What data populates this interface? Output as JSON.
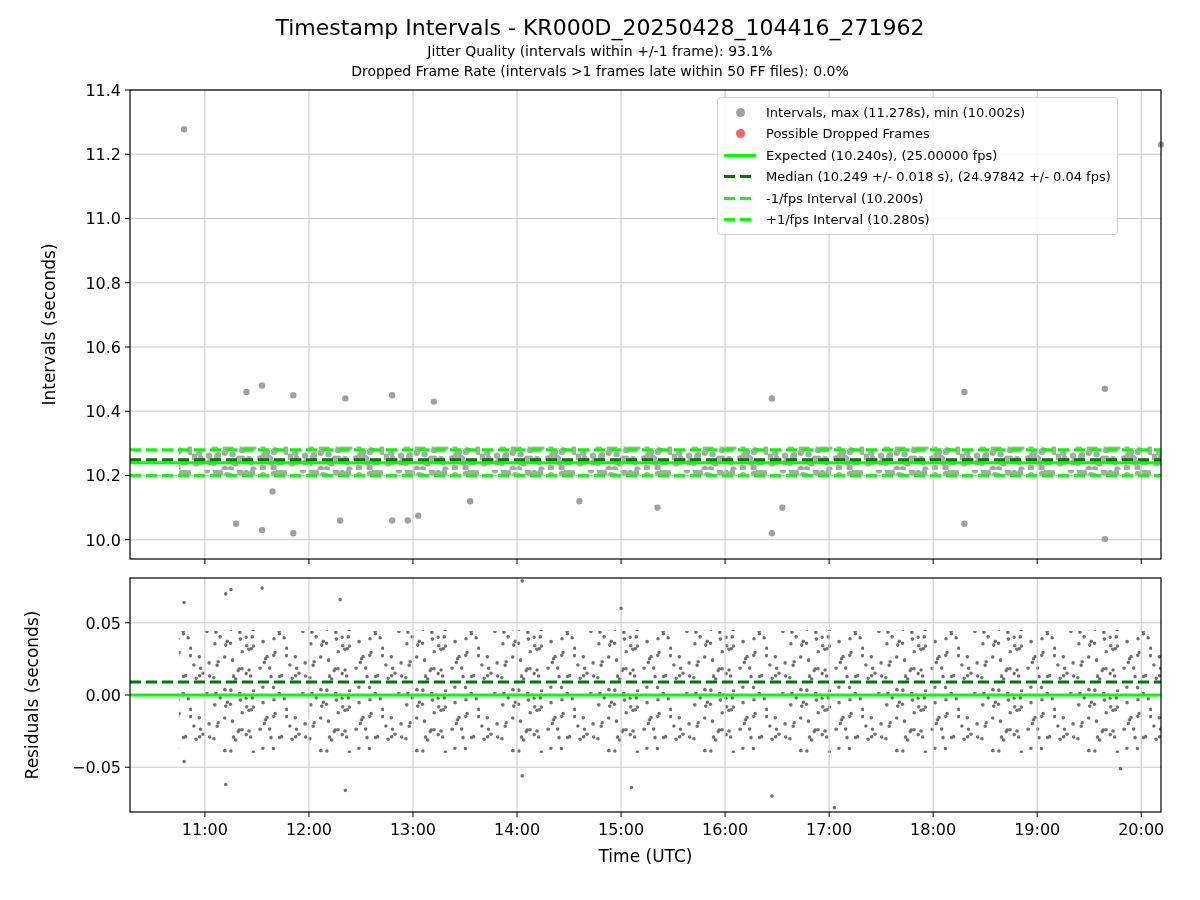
{
  "title": "Timestamp Intervals - KR000D_20250428_104416_271962",
  "subtitles": [
    "Jitter Quality (intervals within +/-1 frame): 93.1%",
    "Dropped Frame Rate (intervals >1 frames late within 50 FF files): 0.0%"
  ],
  "top_panel": {
    "legend_markers": [
      {
        "label": "Possible Dropped Frames",
        "color": "#ff6060"
      }
    ],
    "chart_data": {
      "type": "scatter",
      "ylabel": "Intervals (seconds)",
      "grid": true,
      "xlim": [
        10.28,
        20.19
      ],
      "ylim": [
        9.94,
        11.4
      ],
      "yticks": [
        {
          "value": 10.0,
          "label": "10.0"
        },
        {
          "value": 10.2,
          "label": "10.2"
        },
        {
          "value": 10.4,
          "label": "10.4"
        },
        {
          "value": 10.6,
          "label": "10.6"
        },
        {
          "value": 10.8,
          "label": "10.8"
        },
        {
          "value": 11.0,
          "label": "11.0"
        },
        {
          "value": 11.2,
          "label": "11.2"
        },
        {
          "value": 11.4,
          "label": "11.4"
        }
      ],
      "series": [
        {
          "name": "Intervals, max (11.278s), min (10.002s)",
          "color": "#a0a0a0",
          "x": [
            10.8,
            20.19,
            11.55,
            11.4,
            11.85,
            12.8,
            18.3,
            19.65,
            12.35,
            16.45,
            13.2,
            11.3,
            11.85,
            11.55,
            12.3,
            12.8,
            12.95,
            13.05,
            15.35,
            16.45,
            18.3,
            19.65,
            16.55,
            14.6,
            13.55,
            11.65
          ],
          "values": [
            11.278,
            11.23,
            10.48,
            10.46,
            10.45,
            10.45,
            10.46,
            10.47,
            10.44,
            10.44,
            10.43,
            10.05,
            10.02,
            10.03,
            10.06,
            10.06,
            10.06,
            10.075,
            10.1,
            10.02,
            10.05,
            10.002,
            10.1,
            10.12,
            10.12,
            10.15
          ]
        },
        {
          "name": "Expected (10.240s), (25.00000 fps)",
          "type": "line",
          "line_style": "solid",
          "color": "#00ff00",
          "x": [
            10.28,
            20.19
          ],
          "values": [
            10.24,
            10.24
          ]
        },
        {
          "name": "Median (10.249 +/- 0.018 s), (24.97842 +/- 0.04 fps)",
          "type": "line",
          "line_style": "dashed",
          "color": "#007a00",
          "x": [
            10.28,
            20.19
          ],
          "values": [
            10.249,
            10.249
          ]
        },
        {
          "name": "-1/fps Interval (10.200s)",
          "type": "line",
          "line_style": "dashed",
          "color": "#22ee22",
          "x": [
            10.28,
            20.19
          ],
          "values": [
            10.2,
            10.2
          ]
        },
        {
          "name": "+1/fps Interval (10.280s)",
          "type": "line",
          "line_style": "dashed",
          "color": "#00ff00",
          "x": [
            10.28,
            20.19
          ],
          "values": [
            10.28,
            10.28
          ]
        }
      ]
    }
  },
  "bottom_panel": {
    "chart_data": {
      "type": "scatter",
      "xlabel": "Time (UTC)",
      "ylabel": "Residuals (seconds)",
      "grid": true,
      "xlim": [
        10.28,
        20.19
      ],
      "ylim": [
        -0.081,
        0.081
      ],
      "xticks": [
        {
          "value": 11,
          "label": "11:00"
        },
        {
          "value": 12,
          "label": "12:00"
        },
        {
          "value": 13,
          "label": "13:00"
        },
        {
          "value": 14,
          "label": "14:00"
        },
        {
          "value": 15,
          "label": "15:00"
        },
        {
          "value": 16,
          "label": "16:00"
        },
        {
          "value": 17,
          "label": "17:00"
        },
        {
          "value": 18,
          "label": "18:00"
        },
        {
          "value": 19,
          "label": "19:00"
        },
        {
          "value": 20,
          "label": "20:00"
        }
      ],
      "yticks": [
        {
          "value": -0.05,
          "label": "−0.05"
        },
        {
          "value": 0,
          "label": "0.00"
        },
        {
          "value": 0.05,
          "label": "0.05"
        }
      ],
      "series": [
        {
          "color": "#707070",
          "x": [
            10.8,
            11.2,
            11.25,
            11.55,
            12.3,
            17.05,
            16.45,
            12.35,
            15.1,
            19.8,
            11.2,
            10.8,
            14.05,
            14.05,
            15.0
          ],
          "values": [
            0.064,
            0.07,
            0.073,
            0.074,
            0.066,
            -0.078,
            -0.07,
            -0.066,
            -0.064,
            -0.051,
            -0.062,
            -0.046,
            -0.056,
            0.079,
            0.06
          ]
        },
        {
          "type": "line",
          "line_style": "solid",
          "color": "#00ff00",
          "x": [
            10.28,
            20.19
          ],
          "values": [
            0,
            0
          ]
        },
        {
          "type": "line",
          "line_style": "dashed",
          "color": "#007a00",
          "x": [
            10.28,
            20.19
          ],
          "values": [
            0.009,
            0.009
          ]
        }
      ]
    }
  }
}
